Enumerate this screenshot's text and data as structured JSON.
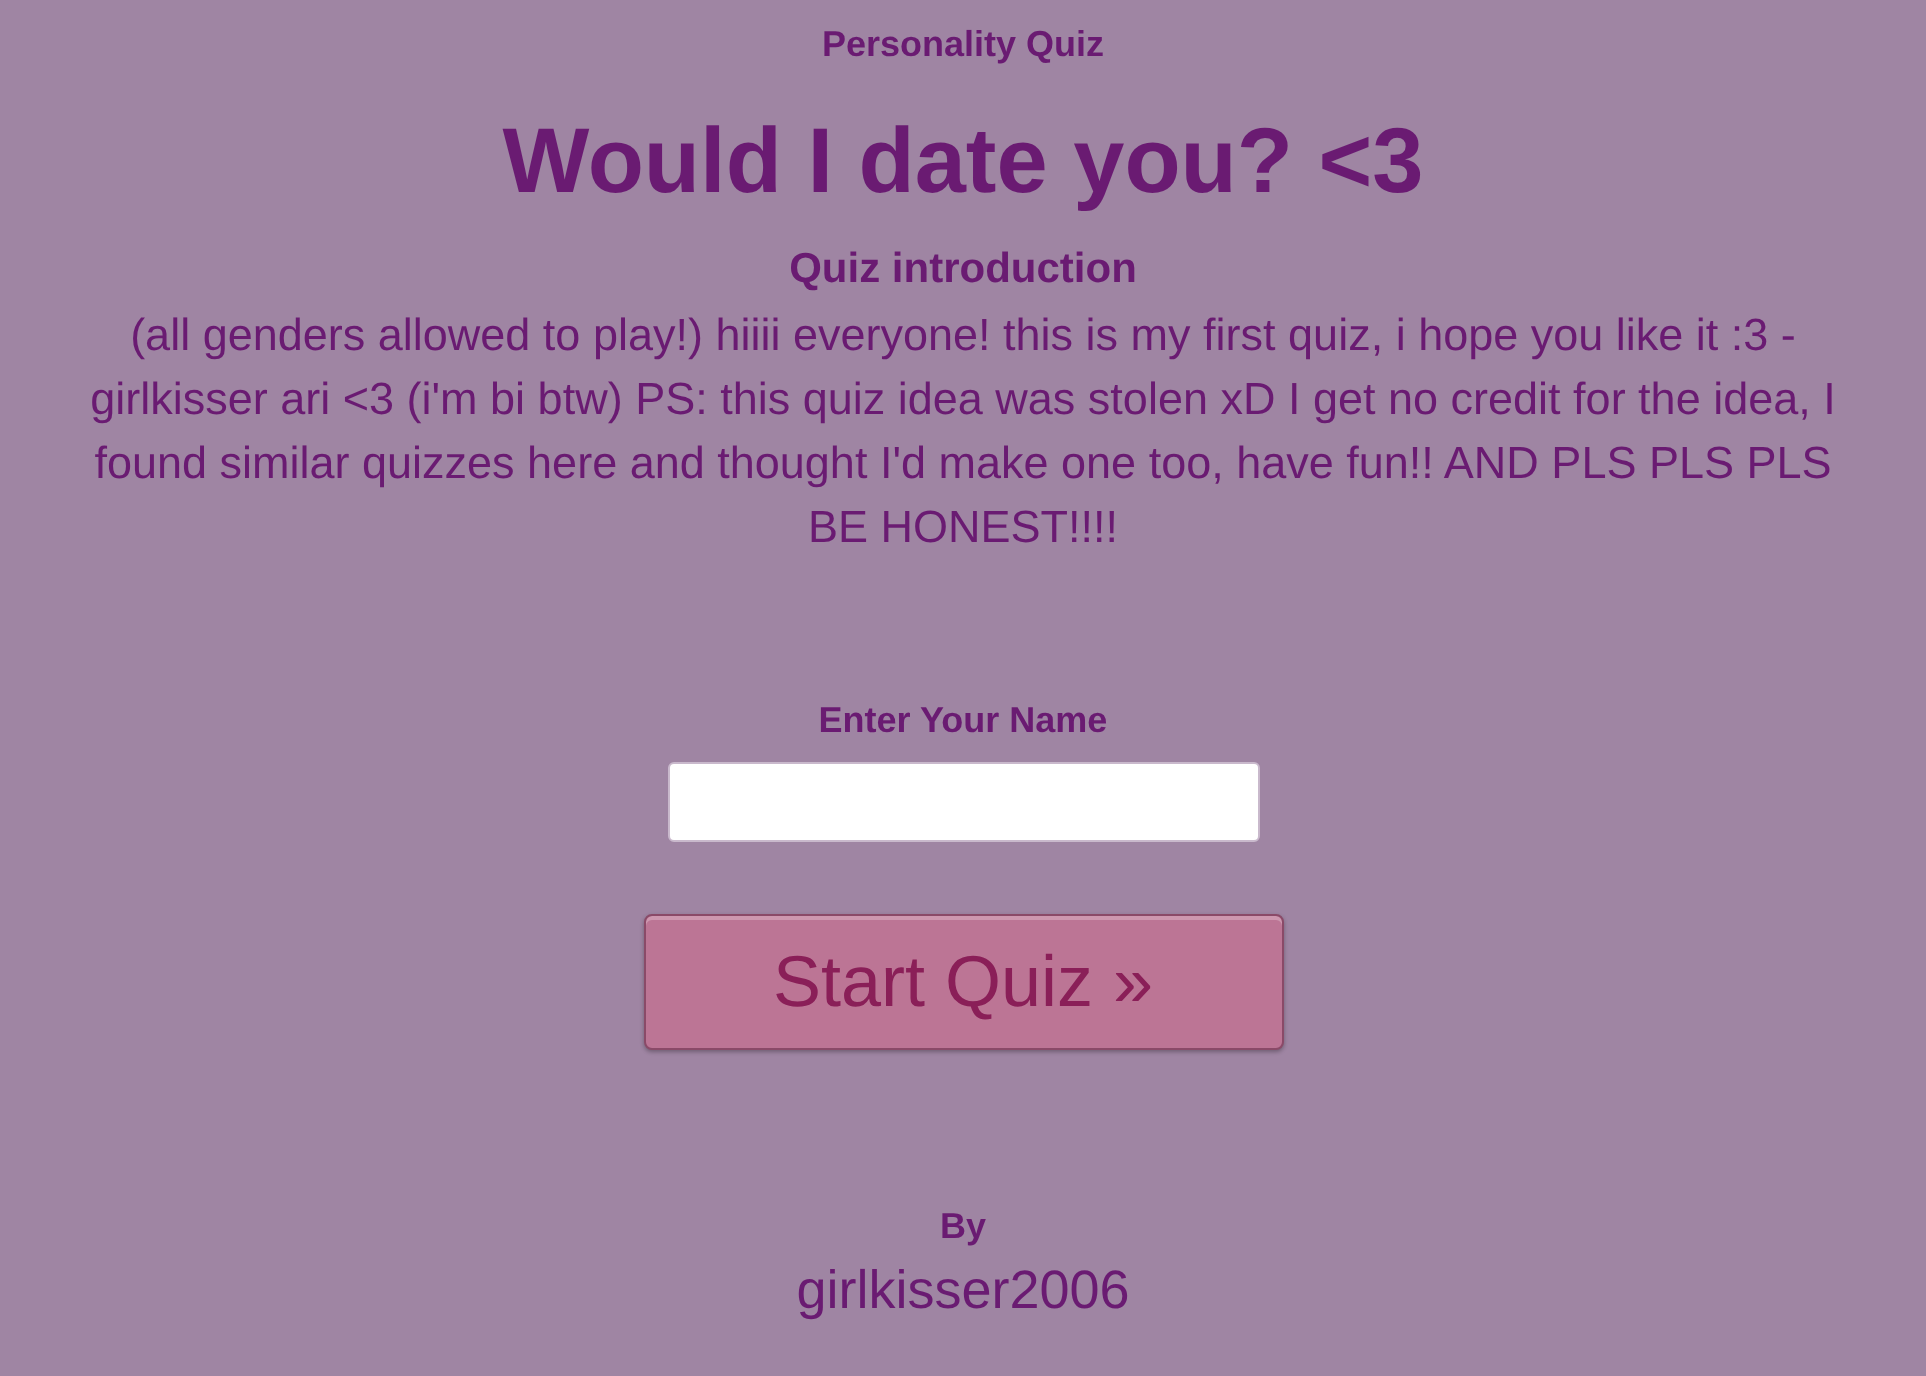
{
  "category": "Personality Quiz",
  "title": "Would I date you? <3",
  "intro_heading": "Quiz introduction",
  "intro_text": "(all genders allowed to play!) hiiii everyone! this is my first quiz, i hope you like it :3 - girlkisser ari <3 (i'm bi btw) PS: this quiz idea was stolen xD I get no credit for the idea, I found similar quizzes here and thought I'd make one too, have fun!! AND PLS PLS PLS BE HONEST!!!!",
  "name_label": "Enter Your Name",
  "start_button": "Start Quiz »",
  "by_label": "By",
  "author": "girlkisser2006"
}
